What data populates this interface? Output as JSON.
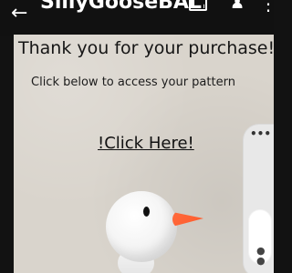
{
  "header": {
    "title": "SillyGooseBAL...",
    "icons": {
      "back": "arrow-left-icon",
      "drive": "drive-icon",
      "add_person": "add-person-icon",
      "more": "more-vertical-icon"
    }
  },
  "content": {
    "heading": "Thank you for your purchase!",
    "subtext": "Click below to access your pattern",
    "link_text": "!Click Here!"
  },
  "image": {
    "subject": "crochet goose applique",
    "colors": {
      "body": "#f3f3f3",
      "beak": "#ff5d2f",
      "eye": "#111111"
    }
  },
  "floating_panel": {
    "more_label": "•••",
    "control_icon": "● ●"
  },
  "colors": {
    "page_background": "#d9d4cc",
    "topbar_background": "#111111",
    "text_primary": "#161616"
  }
}
